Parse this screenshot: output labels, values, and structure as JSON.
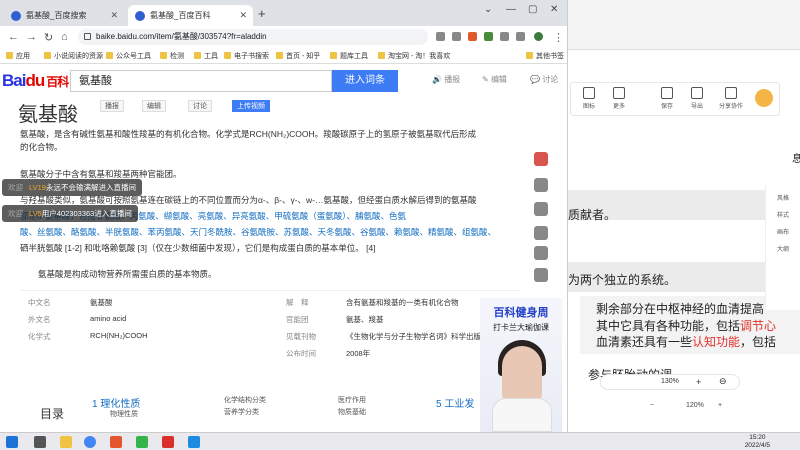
{
  "browser": {
    "tabs": [
      {
        "label": "氨基酸_百度搜索"
      },
      {
        "label": "氨基酸_百度百科"
      }
    ],
    "url": "baike.baidu.com/item/氨基酸/303574?fr=aladdin",
    "bookmarks": [
      "应用",
      "小说阅读的资源",
      "公众号工具",
      "检测",
      "工具",
      "电子书搜索",
      "首页 - 知乎",
      "题库工具",
      "淘宝网 - 淘！我喜欢",
      "其他书签"
    ]
  },
  "baike": {
    "logo_main": "Bai",
    "logo_paw": "du",
    "logo_baike": "百科",
    "search_value": "氨基酸",
    "search_button": "进入词条",
    "header_actions": [
      "播报",
      "编辑",
      "讨论"
    ],
    "title": "氨基酸",
    "title_actions": [
      "播报",
      "编辑",
      "讨论",
      "上传视频"
    ],
    "para1_line1": "氨基酸，是含有碱性氨基和酸性羧基的有机化合物。化学式是RCH(NH₂)COOH。羧酸碳原子上的氢原子被氨基取代后形成",
    "para1_line2": "的化合物。",
    "para2_line1": "氨基酸分子中含有氨基和羧基两种官能团。",
    "para2_line2": "与羟基酸类似，氨基酸可按照氨基连在碳链上的不同位置而分为α-、β-、γ-、w-…氨基酸，但经蛋白质水解后得到的氨基酸",
    "para2_line3": "都是α-氨基酸，包括甘氨酸、丙氨酸、缬氨酸、亮氨酸、异亮氨酸、甲硫氨酸（蛋氨酸）、脯氨酸、色氨",
    "para2_line4": "酸、丝氨酸、酪氨酸、半胱氨酸、苯丙氨酸、天门冬酰胺、谷氨酰胺、苏氨酸、天冬氨酸、谷氨酸、赖氨酸、精氨酸、组氨酸、",
    "para2_line5": "硒半胱氨酸 [1-2] 和吡咯赖氨酸 [3]（仅在少数细菌中发现），它们是构成蛋白质的基本单位。 [4]",
    "para3": "氨基酸是构成动物营养所需蛋白质的基本物质。",
    "overlay1": {
      "close": "欢迎",
      "level": "LV19",
      "text": "永远不会输满解进入直播间"
    },
    "overlay2": {
      "close": "欢迎",
      "level": "LV5",
      "text": "用户402303363进入直播间"
    },
    "info_left": [
      {
        "k": "中文名",
        "v": "氨基酸"
      },
      {
        "k": "外文名",
        "v": "amino acid"
      },
      {
        "k": "化学式",
        "v": "RCH(NH₂)COOH"
      }
    ],
    "info_right": [
      {
        "k": "解　释",
        "v": "含有氨基和羧基的一类有机化合物"
      },
      {
        "k": "官能团",
        "v": "氨基、羧基"
      },
      {
        "k": "见载刊物",
        "v": "《生物化学与分子生物学名词》科学出版社"
      },
      {
        "k": "公布时间",
        "v": "2008年"
      }
    ],
    "promo": {
      "title": "百科健身周",
      "subtitle": "打卡兰大瑜伽课"
    },
    "toc_label": "目录",
    "toc_items": [
      "1 理化性质",
      "化学结构分类",
      "营养学分类",
      "医疗作用",
      "物质基础",
      "5 工业发"
    ],
    "toc_sub": "物理性质"
  },
  "bgapp": {
    "toolbar": [
      "图标",
      "更多",
      "保存",
      "导出",
      "分享协作"
    ],
    "side": [
      "风格",
      "样式",
      "画布",
      "大纲"
    ],
    "text1": "质献者。",
    "text2": "为两个独立的系统。",
    "text3a": "剩余部分在中枢神经的血清",
    "text3b": "提高",
    "text4a": "其中它具有各种功能，包括",
    "text4b": "调节心",
    "text5a": "血清素还具有一些",
    "text5b": "认知功能",
    "text5c": "，包括",
    "text6": "参与胚胎动的调",
    "zoom1": "130%",
    "zoom2": "120%",
    "misc": "息"
  },
  "taskbar": {
    "time": "15:20",
    "date": "2022/4/5"
  }
}
